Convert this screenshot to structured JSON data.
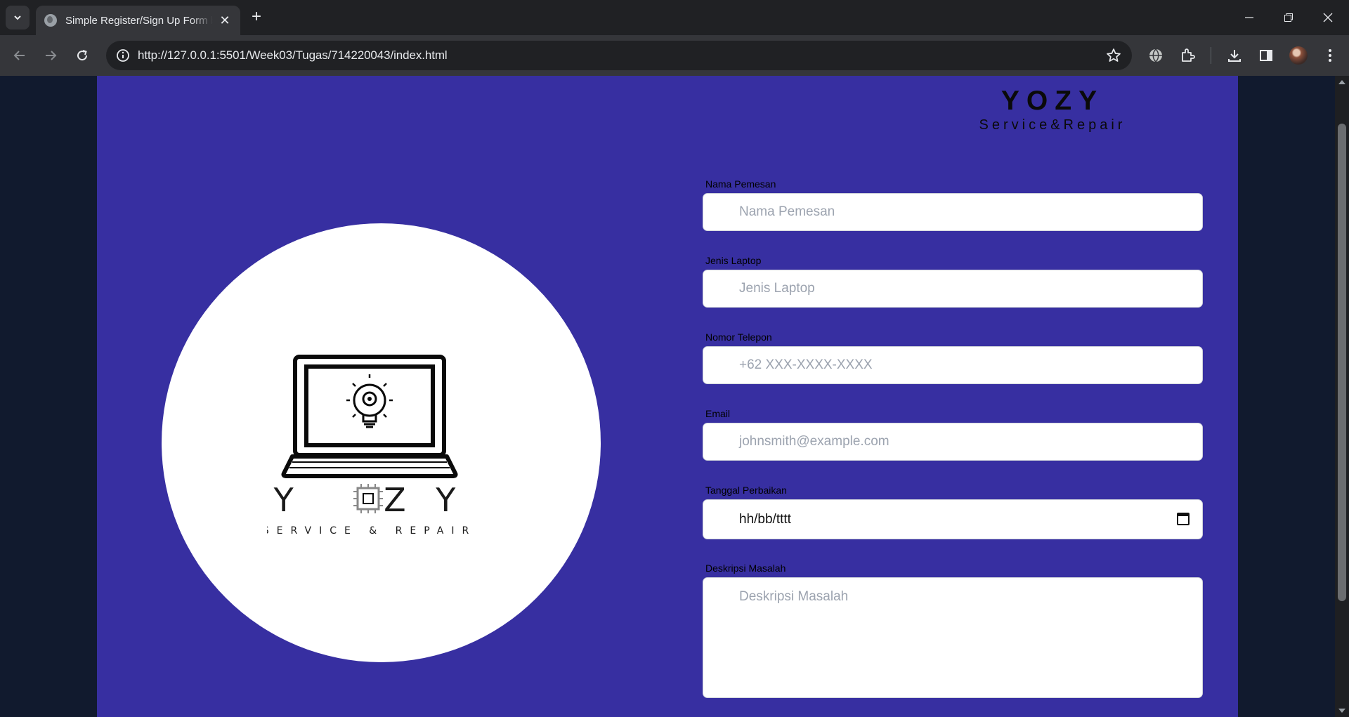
{
  "browser": {
    "tab_title": "Simple Register/Sign Up Form by",
    "url": "http://127.0.0.1:5501/Week03/Tugas/714220043/index.html"
  },
  "brand": {
    "name": "YOZY",
    "tagline": "Service&Repair"
  },
  "logo": {
    "name": "Y    Z Y",
    "tagline": "SERVICE & REPAIR"
  },
  "form": {
    "fields": [
      {
        "label": "Nama Pemesan",
        "placeholder": "Nama Pemesan"
      },
      {
        "label": "Jenis Laptop",
        "placeholder": "Jenis Laptop"
      },
      {
        "label": "Nomor Telepon",
        "placeholder": "+62 XXX-XXXX-XXXX"
      },
      {
        "label": "Email",
        "placeholder": "johnsmith@example.com"
      },
      {
        "label": "Tanggal Perbaikan",
        "value": "hh/bb/tttt"
      },
      {
        "label": "Deskripsi Masalah",
        "placeholder": "Deskripsi Masalah"
      }
    ]
  },
  "colors": {
    "card_bg": "#372fa1",
    "page_bg": "#111a2e",
    "logo_bg": "#ffffff"
  }
}
